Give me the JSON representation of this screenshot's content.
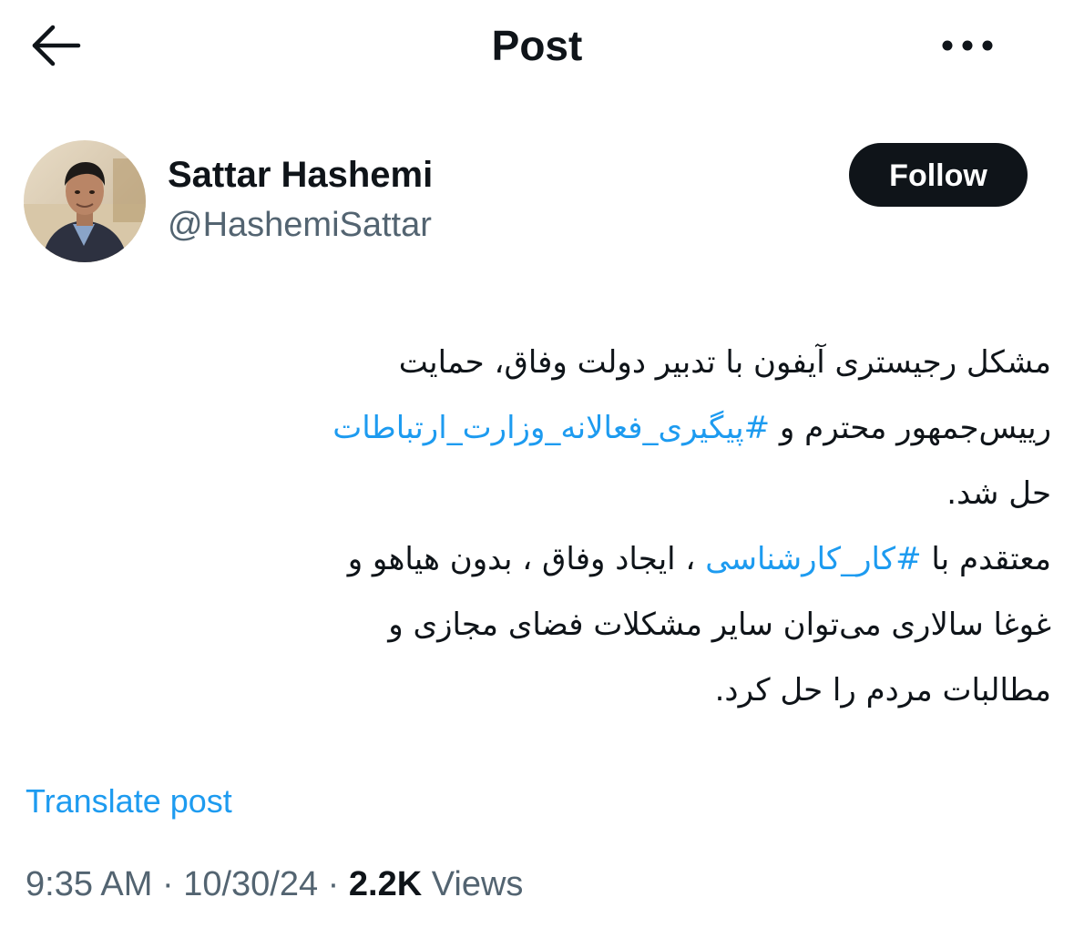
{
  "header": {
    "title": "Post",
    "back_icon": "arrow-left-icon",
    "more_icon": "more-horizontal-icon"
  },
  "author": {
    "display_name": "Sattar Hashemi",
    "handle": "@HashemiSattar",
    "avatar": "profile-photo",
    "follow_label": "Follow"
  },
  "tweet": {
    "lines": [
      [
        {
          "text": "مشکل رجیستری آیفون با تدبیر دولت  وفاق، حمایت",
          "hashtag": false
        }
      ],
      [
        {
          "text": "رییس‌جمهور محترم و ",
          "hashtag": false
        },
        {
          "text": "#پیگیری_فعالانه_وزارت_ارتباطات",
          "hashtag": true
        }
      ],
      [
        {
          "text": "حل شد.",
          "hashtag": false
        }
      ],
      [
        {
          "text": "معتقدم با ",
          "hashtag": false
        },
        {
          "text": "#کار_کارشناسی",
          "hashtag": true
        },
        {
          "text": " ، ایجاد وفاق ، بدون هیاهو و",
          "hashtag": false
        }
      ],
      [
        {
          "text": "غوغا سالاری می‌توان سایر مشکلات فضای مجازی و",
          "hashtag": false
        }
      ],
      [
        {
          "text": "مطالبات مردم را حل کرد.",
          "hashtag": false
        }
      ]
    ],
    "translate_label": "Translate post"
  },
  "meta": {
    "time": "9:35 AM",
    "separator": " · ",
    "date": "10/30/24",
    "views_count": "2.2K",
    "views_label": "Views"
  },
  "colors": {
    "text": "#0f1419",
    "secondary": "#536471",
    "link": "#1d9bf0",
    "follow_bg": "#0f1419",
    "follow_text": "#ffffff",
    "background": "#ffffff"
  }
}
